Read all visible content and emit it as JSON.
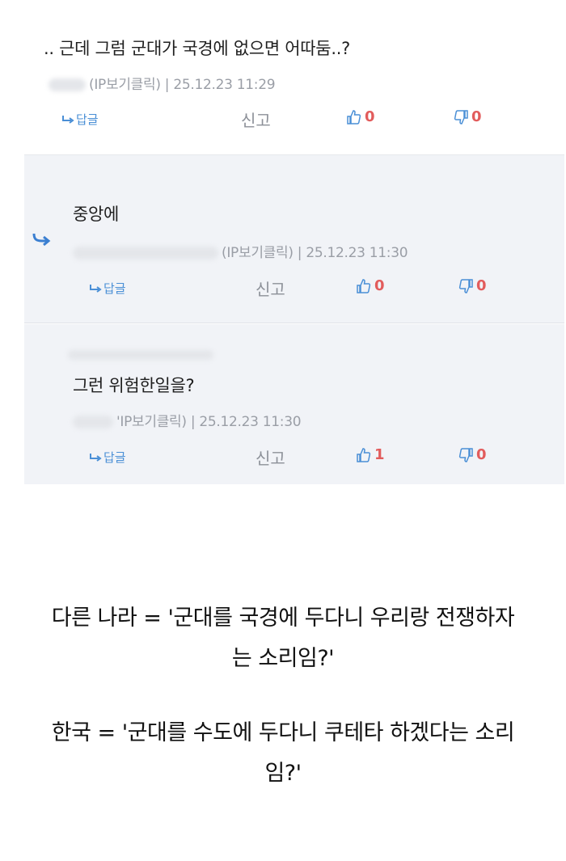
{
  "comments": [
    {
      "text": ".. 근데 그럼 군대가 국경에 없으면 어따둠..?",
      "meta": "(IP보기클릭) | 25.12.23 11:29",
      "reply_label": "답글",
      "report_label": "신고",
      "likes": "0",
      "dislikes": "0"
    },
    {
      "text": "중앙에",
      "meta": "(IP보기클릭) | 25.12.23 11:30",
      "reply_label": "답글",
      "report_label": "신고",
      "likes": "0",
      "dislikes": "0"
    },
    {
      "text": "그런 위험한일을?",
      "meta": "'IP보기클릭) | 25.12.23 11:30",
      "reply_label": "답글",
      "report_label": "신고",
      "likes": "1",
      "dislikes": "0"
    }
  ],
  "caption": {
    "line1": "다른 나라 = '군대를 국경에 두다니 우리랑 전쟁하자",
    "line2": "는 소리임?'",
    "line3": "한국 = '군대를 수도에 두다니 쿠테타 하겠다는 소리",
    "line4": "임?'"
  },
  "colors": {
    "accent_blue": "#4a8fd6",
    "vote_red": "#e25c5c",
    "reply_bg": "#f1f3f7"
  }
}
